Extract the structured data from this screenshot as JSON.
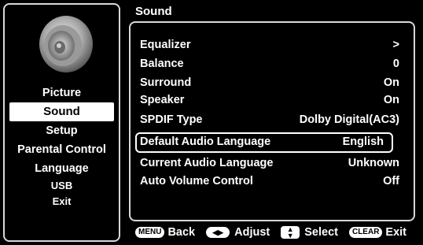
{
  "header": {
    "title": "Sound"
  },
  "sidebar": {
    "items": [
      {
        "label": "Picture",
        "selected": false
      },
      {
        "label": "Sound",
        "selected": true
      },
      {
        "label": "Setup",
        "selected": false
      },
      {
        "label": "Parental Control",
        "selected": false
      },
      {
        "label": "Language",
        "selected": false
      },
      {
        "label": "USB",
        "selected": false
      },
      {
        "label": "Exit",
        "selected": false
      }
    ]
  },
  "settings": [
    {
      "label": "Equalizer",
      "value": ">"
    },
    {
      "label": "Balance",
      "value": "0"
    },
    {
      "label": "Surround",
      "value": "On"
    },
    {
      "label": "Speaker",
      "value": "On"
    },
    {
      "label": "SPDIF Type",
      "value": "Dolby Digital(AC3)"
    },
    {
      "label": "Default Audio Language",
      "value": "English",
      "highlighted": true
    },
    {
      "label": "Current Audio Language",
      "value": "Unknown"
    },
    {
      "label": "Auto Volume Control",
      "value": "Off"
    }
  ],
  "footer": {
    "menu_key": "MENU",
    "back_label": "Back",
    "adjust_label": "Adjust",
    "select_label": "Select",
    "clear_key": "CLEAR",
    "exit_label": "Exit"
  },
  "icons": {
    "speaker": "speaker-icon"
  }
}
